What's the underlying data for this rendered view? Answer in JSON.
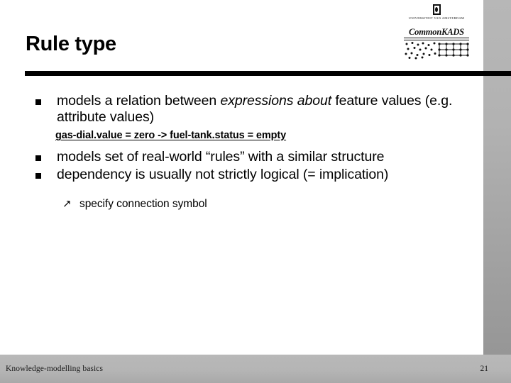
{
  "slide": {
    "title": "Rule type",
    "logos": {
      "university_name": "UNIVERSITEIT VAN AMSTERDAM",
      "methodology_name": "CommonKADS"
    },
    "bullets": [
      {
        "marker": "square",
        "text_before_italic": "models a relation between ",
        "italic_text": "expressions about",
        "text_after_italic": " feature values (e.g. attribute values)"
      },
      {
        "marker": "square",
        "text": "models set of real-world “rules” with a similar structure"
      },
      {
        "marker": "square",
        "text": "dependency is usually not strictly logical (= implication)"
      }
    ],
    "example": {
      "text": "gas-dial.value = zero -> fuel-tank.status = empty"
    },
    "subbullet": {
      "marker": "↗",
      "text": "specify connection symbol"
    },
    "footer": {
      "left_label": "Knowledge-modelling basics",
      "page_number": "21"
    },
    "colors": {
      "rule": "#000000",
      "band_gray_top": "#b7b7b7",
      "band_gray_bottom": "#969696",
      "footer_gray": "#b5b5b5",
      "background": "#ffffff"
    }
  }
}
